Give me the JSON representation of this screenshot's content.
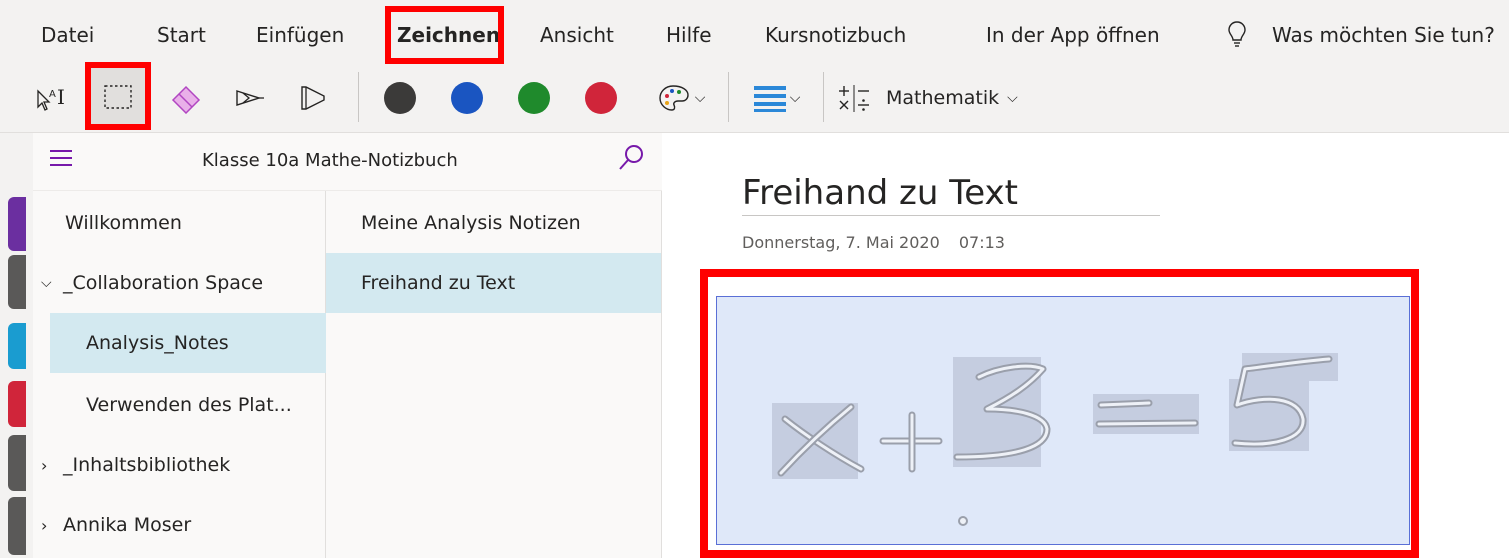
{
  "ribbon": {
    "tabs": [
      "Datei",
      "Start",
      "Einfügen",
      "Zeichnen",
      "Ansicht",
      "Hilfe",
      "Kursnotizbuch",
      "In der App öffnen"
    ],
    "active_tab": "Zeichnen",
    "tell_me": "Was möchten Sie tun?",
    "math_label": "Mathematik",
    "pen_colors": [
      "#3b3a39",
      "#1a55c1",
      "#1f8a2c",
      "#d0253a"
    ],
    "accent": "#ff0000"
  },
  "notebook": {
    "title": "Klasse 10a Mathe-Notizbuch"
  },
  "sections": [
    {
      "label": "Willkommen",
      "indent": false,
      "selected": false
    },
    {
      "label": "_Collaboration Space",
      "indent": false,
      "expanded": true
    },
    {
      "label": "Analysis_Notes",
      "indent": true,
      "selected": true
    },
    {
      "label": "Verwenden des Plat...",
      "indent": true
    },
    {
      "label": "_Inhaltsbibliothek",
      "indent": false,
      "expanded": false
    },
    {
      "label": "Annika Moser",
      "indent": false,
      "expanded": false
    }
  ],
  "pages": [
    {
      "label": "Meine Analysis Notizen",
      "selected": false
    },
    {
      "label": "Freihand zu Text",
      "selected": true
    }
  ],
  "page": {
    "title": "Freihand zu Text",
    "date": "Donnerstag, 7. Mai 2020",
    "time": "07:13"
  },
  "icons": {
    "tell_me": "lightbulb-icon",
    "hamburger": "hamburger-icon",
    "search": "search-icon"
  }
}
